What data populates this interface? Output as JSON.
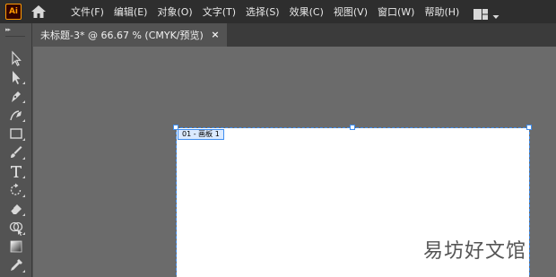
{
  "app": {
    "logo_text": "Ai",
    "logo_color": "#ff9a00"
  },
  "menu": {
    "items": [
      {
        "label": "文件(F)"
      },
      {
        "label": "编辑(E)"
      },
      {
        "label": "对象(O)"
      },
      {
        "label": "文字(T)"
      },
      {
        "label": "选择(S)"
      },
      {
        "label": "效果(C)"
      },
      {
        "label": "视图(V)"
      },
      {
        "label": "窗口(W)"
      },
      {
        "label": "帮助(H)"
      }
    ],
    "icons": [
      "home-icon",
      "workspace-layout-icon",
      "chevron-down-icon"
    ]
  },
  "toolbar": {
    "grip": "▸▸",
    "tools": [
      "selection-tool-icon",
      "direct-selection-tool-icon",
      "pen-tool-icon",
      "curvature-tool-icon",
      "rectangle-tool-icon",
      "paintbrush-tool-icon",
      "type-tool-icon",
      "rotate-tool-icon",
      "eraser-tool-icon",
      "shape-builder-tool-icon",
      "gradient-tool-icon",
      "eyedropper-tool-icon"
    ]
  },
  "document": {
    "tab_title": "未标题-3* @ 66.67 % (CMYK/预览)",
    "close_glyph": "×"
  },
  "canvas": {
    "artboard_label": "01 - 画板 1",
    "selection_color": "#3f8ef0"
  },
  "watermark": {
    "text": "易坊好文馆"
  }
}
